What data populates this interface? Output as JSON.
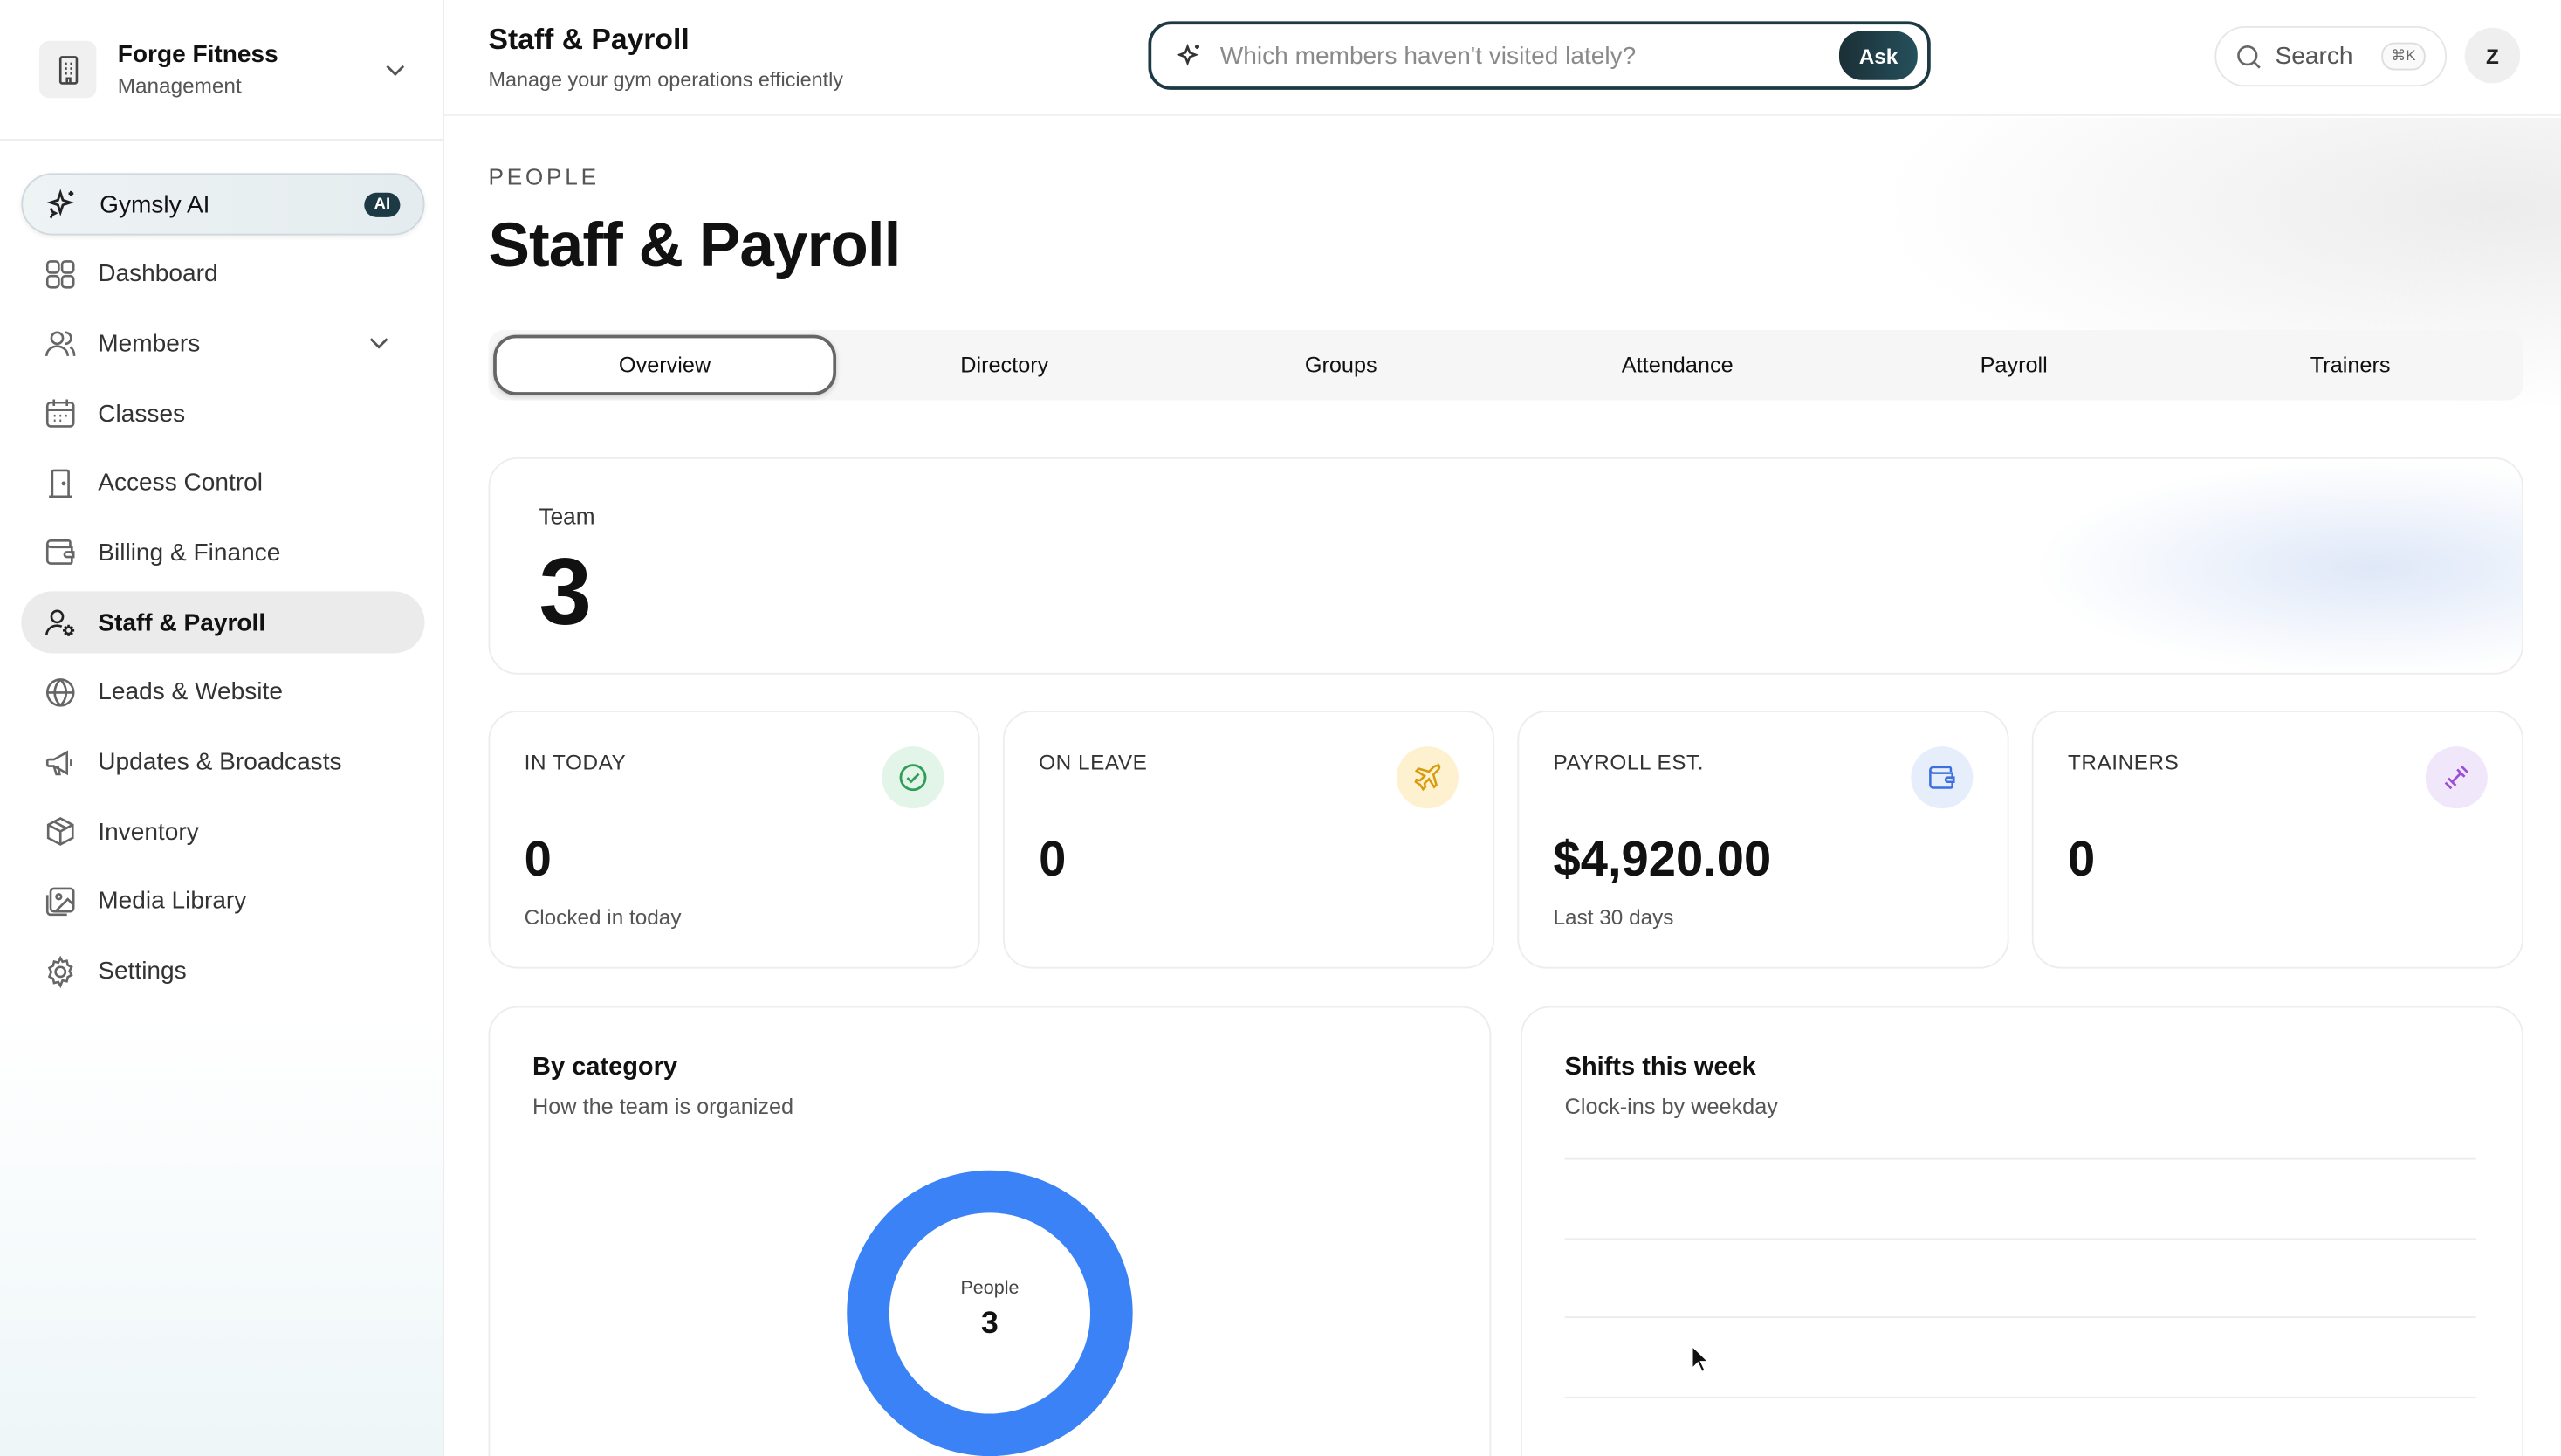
{
  "org": {
    "name": "Forge Fitness",
    "subtitle": "Management"
  },
  "sidebar": {
    "items": [
      {
        "label": "Gymsly AI",
        "icon": "sparkles-icon",
        "badge": "AI"
      },
      {
        "label": "Dashboard",
        "icon": "grid-icon"
      },
      {
        "label": "Members",
        "icon": "users-icon",
        "expandable": true
      },
      {
        "label": "Classes",
        "icon": "calendar-icon"
      },
      {
        "label": "Access Control",
        "icon": "door-icon"
      },
      {
        "label": "Billing & Finance",
        "icon": "wallet-icon"
      },
      {
        "label": "Staff & Payroll",
        "icon": "user-gear-icon",
        "active": true
      },
      {
        "label": "Leads & Website",
        "icon": "globe-icon"
      },
      {
        "label": "Updates & Broadcasts",
        "icon": "megaphone-icon"
      },
      {
        "label": "Inventory",
        "icon": "box-icon"
      },
      {
        "label": "Media Library",
        "icon": "image-icon"
      },
      {
        "label": "Settings",
        "icon": "gear-icon"
      }
    ]
  },
  "header": {
    "title": "Staff & Payroll",
    "subtitle": "Manage your gym operations efficiently",
    "ask": {
      "placeholder": "Which members haven't visited lately?",
      "button": "Ask"
    },
    "search": {
      "label": "Search",
      "shortcut": "⌘K"
    },
    "avatar": "Z"
  },
  "page": {
    "eyebrow": "PEOPLE",
    "title": "Staff & Payroll",
    "tabs": [
      {
        "label": "Overview",
        "active": true
      },
      {
        "label": "Directory"
      },
      {
        "label": "Groups"
      },
      {
        "label": "Attendance"
      },
      {
        "label": "Payroll"
      },
      {
        "label": "Trainers"
      }
    ],
    "team": {
      "label": "Team",
      "value": "3"
    },
    "stats": [
      {
        "label": "IN TODAY",
        "value": "0",
        "sub": "Clocked in today",
        "icon": "check-circle-icon",
        "bg": "#e3f5e8",
        "fg": "#2f9e57"
      },
      {
        "label": "ON LEAVE",
        "value": "0",
        "sub": "",
        "icon": "plane-icon",
        "bg": "#fdf1cf",
        "fg": "#d99a0b"
      },
      {
        "label": "PAYROLL EST.",
        "value": "$4,920.00",
        "sub": "Last 30 days",
        "icon": "wallet-icon",
        "bg": "#e6edfb",
        "fg": "#3d6fe0"
      },
      {
        "label": "TRAINERS",
        "value": "0",
        "sub": "",
        "icon": "dumbbell-icon",
        "bg": "#f1e7fb",
        "fg": "#9b4fd6"
      }
    ],
    "by_category": {
      "title": "By category",
      "subtitle": "How the team is organized",
      "center_label": "People",
      "center_value": "3",
      "color": "#3b82f6"
    },
    "shifts": {
      "title": "Shifts this week",
      "subtitle": "Clock-ins by weekday"
    }
  },
  "colors": {
    "accent": "#1d3a44",
    "active_nav": "#ebebeb",
    "donut": "#3b82f6"
  }
}
